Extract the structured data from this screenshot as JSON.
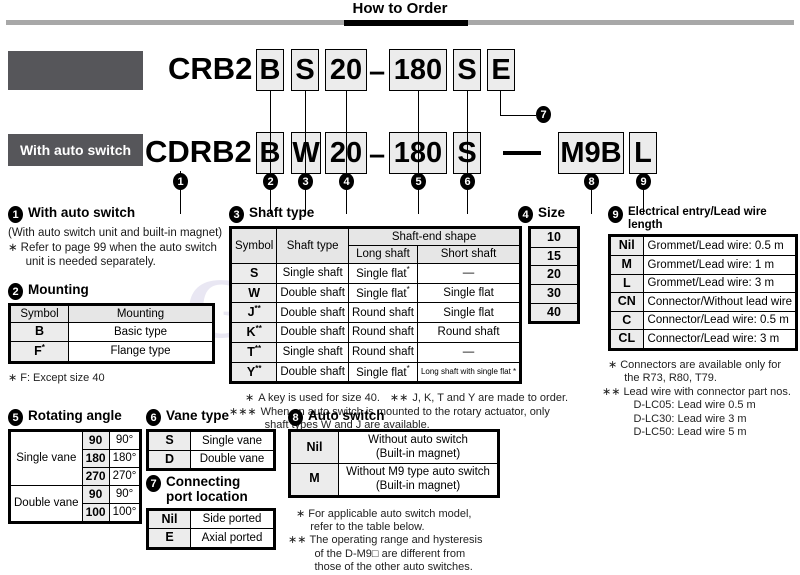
{
  "header": {
    "title": "How to Order"
  },
  "model": {
    "row1": {
      "root": "CRB2",
      "boxes": [
        "B",
        "S",
        "20",
        "180",
        "S",
        "E"
      ],
      "dash": "–"
    },
    "row2": {
      "label": "With auto switch",
      "root": "CDRB2",
      "boxes": [
        "B",
        "W",
        "20",
        "180",
        "S",
        "M9B",
        "L"
      ],
      "dash": "–"
    },
    "markers": [
      "1",
      "2",
      "3",
      "4",
      "5",
      "6",
      "7",
      "8",
      "9"
    ]
  },
  "sections": {
    "s1": {
      "num": "1",
      "title": "With auto switch",
      "line1": "(With auto switch unit and built-in magnet)",
      "line2": "Refer to page 99 when the auto switch",
      "line3": "unit is needed separately."
    },
    "s2": {
      "num": "2",
      "title": "Mounting",
      "headers": [
        "Symbol",
        "Mounting"
      ],
      "rows": [
        {
          "symbol": "B",
          "sup": "",
          "value": "Basic type"
        },
        {
          "symbol": "F",
          "sup": "*",
          "value": "Flange type"
        }
      ],
      "note": "F: Except size 40"
    },
    "s3": {
      "num": "3",
      "title": "Shaft type",
      "headers": {
        "symbol": "Symbol",
        "shaft_type": "Shaft type",
        "shaft_end": "Shaft-end shape",
        "long": "Long shaft",
        "short": "Short shaft"
      },
      "rows": [
        {
          "symbol": "S",
          "sup": "",
          "shaft_type": "Single shaft",
          "long": "Single flat",
          "long_sup": "*",
          "short": "—",
          "short_small": false
        },
        {
          "symbol": "W",
          "sup": "",
          "shaft_type": "Double shaft",
          "long": "Single flat",
          "long_sup": "*",
          "short": "Single flat",
          "short_small": false
        },
        {
          "symbol": "J",
          "sup": "**",
          "shaft_type": "Double shaft",
          "long": "Round shaft",
          "long_sup": "",
          "short": "Single flat",
          "short_small": false
        },
        {
          "symbol": "K",
          "sup": "**",
          "shaft_type": "Double shaft",
          "long": "Round shaft",
          "long_sup": "",
          "short": "Round shaft",
          "short_small": false
        },
        {
          "symbol": "T",
          "sup": "**",
          "shaft_type": "Single shaft",
          "long": "Round shaft",
          "long_sup": "",
          "short": "—",
          "short_small": false
        },
        {
          "symbol": "Y",
          "sup": "**",
          "shaft_type": "Double shaft",
          "long": "Single flat",
          "long_sup": "*",
          "short": "Long shaft with single flat *",
          "short_small": true
        }
      ],
      "note1": "A key is used for size 40.",
      "note2": "J, K, T and Y are made to order.",
      "note3a": "When an auto switch is mounted to the rotary actuator, only",
      "note3b": "shaft types W and J are available."
    },
    "s4": {
      "num": "4",
      "title": "Size",
      "rows": [
        "10",
        "15",
        "20",
        "30",
        "40"
      ]
    },
    "s5": {
      "num": "5",
      "title": "Rotating angle",
      "rows": [
        {
          "vane": "Single vane",
          "span": 3,
          "code": "90",
          "angle": "90°"
        },
        {
          "code": "180",
          "angle": "180°"
        },
        {
          "code": "270",
          "angle": "270°"
        },
        {
          "vane": "Double vane",
          "span": 2,
          "code": "90",
          "angle": "90°"
        },
        {
          "code": "100",
          "angle": "100°"
        }
      ]
    },
    "s6": {
      "num": "6",
      "title": "Vane type",
      "rows": [
        {
          "symbol": "S",
          "value": "Single vane"
        },
        {
          "symbol": "D",
          "value": "Double vane"
        }
      ]
    },
    "s7": {
      "num": "7",
      "title_l1": "Connecting",
      "title_l2": "port location",
      "rows": [
        {
          "symbol": "Nil",
          "value": "Side ported"
        },
        {
          "symbol": "E",
          "value": "Axial ported"
        }
      ]
    },
    "s8": {
      "num": "8",
      "title": "Auto switch",
      "rows": [
        {
          "symbol": "Nil",
          "l1": "Without auto switch",
          "l2": "(Built-in magnet)"
        },
        {
          "symbol": "M",
          "l1": "Without M9 type auto switch",
          "l2": "(Built-in magnet)"
        }
      ],
      "note1a": "For applicable auto switch model,",
      "note1b": "refer to the table below.",
      "note2a": "The operating range and hysteresis",
      "note2b": "of the D-M9□ are different from",
      "note2c": "those of the other auto switches."
    },
    "s9": {
      "num": "9",
      "title": "Electrical entry/Lead wire length",
      "rows": [
        {
          "symbol": "Nil",
          "value": "Grommet/Lead wire: 0.5 m"
        },
        {
          "symbol": "M",
          "value": "Grommet/Lead wire: 1 m"
        },
        {
          "symbol": "L",
          "value": "Grommet/Lead wire: 3 m"
        },
        {
          "symbol": "CN",
          "value": "Connector/Without lead wire"
        },
        {
          "symbol": "C",
          "value": "Connector/Lead wire: 0.5 m"
        },
        {
          "symbol": "CL",
          "value": "Connector/Lead wire: 3 m"
        }
      ],
      "note1a": "Connectors are available only for",
      "note1b": "the R73, R80, T79.",
      "note2a": "Lead wire with connector part nos.",
      "note2b": "D-LC05: Lead wire 0.5 m",
      "note2c": "D-LC30: Lead wire 3 m",
      "note2d": "D-LC50: Lead wire 5 m"
    }
  },
  "watermark": {
    "g": "G",
    "a": "A"
  }
}
